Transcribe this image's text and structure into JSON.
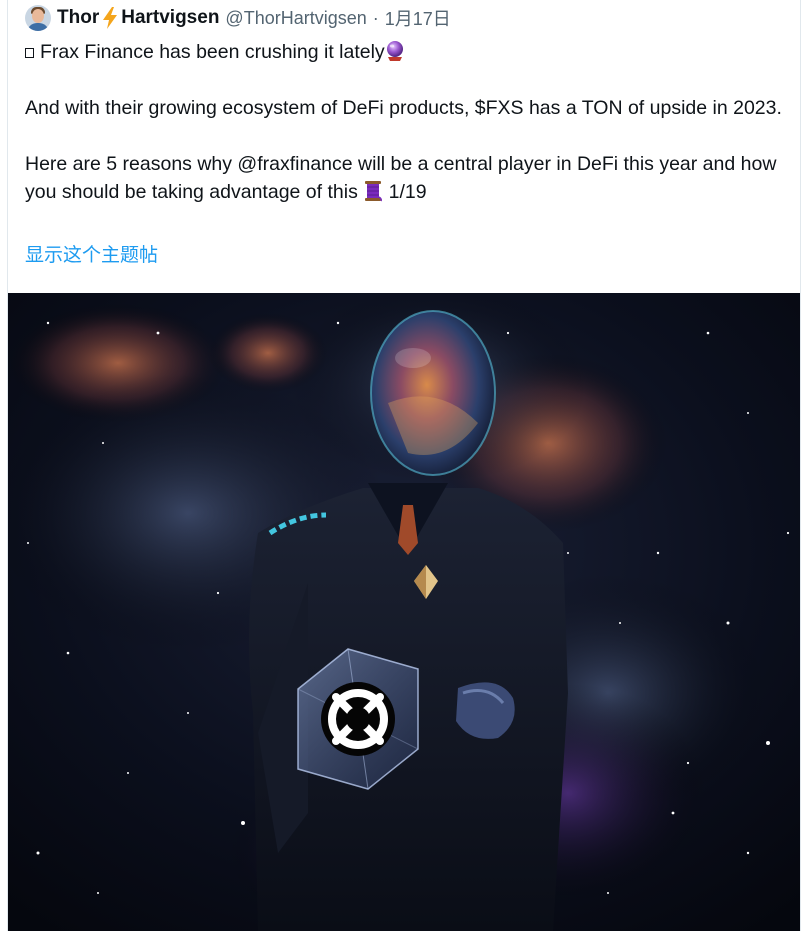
{
  "tweet": {
    "author": {
      "name_part1": "Thor",
      "name_part2": "Hartvigsen",
      "handle": "@ThorHartvigsen",
      "separator": "·",
      "date": "1月17日"
    },
    "lines": {
      "line1": "Frax Finance has been crushing it lately",
      "line2": "And with their growing ecosystem of DeFi products, $FXS has a TON of upside in 2023.",
      "line3": "Here are 5 reasons why @fraxfinance will be a central player in DeFi this year and how you should be taking advantage of this",
      "counter": "1/19"
    },
    "show_thread_label": "显示这个主题帖",
    "icons": {
      "name_emoji": "lightning-bolt-icon",
      "line1_emoji": "crystal-ball-icon",
      "line3_emoji": "thread-spool-icon"
    },
    "colors": {
      "link": "#1d9bf0",
      "text": "#0f1419",
      "muted": "#536471",
      "bolt": "#f4a51c"
    }
  },
  "media": {
    "kind": "image",
    "subject": "space-suited figure with nebula helmet holding a cube with Frax logo"
  }
}
